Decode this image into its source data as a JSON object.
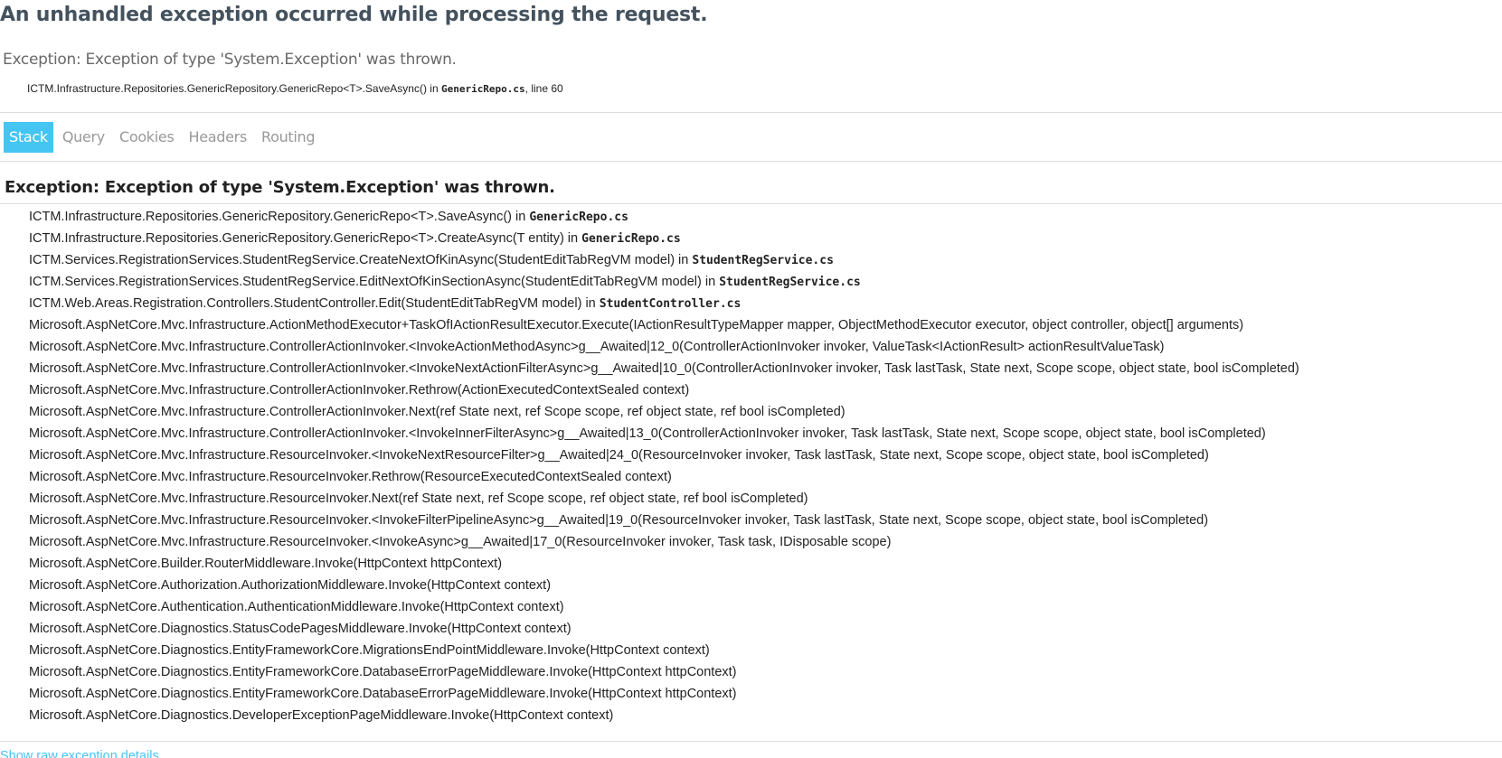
{
  "page": {
    "title": "An unhandled exception occurred while processing the request.",
    "summary": "Exception: Exception of type 'System.Exception' was thrown.",
    "location": {
      "method": "ICTM.Infrastructure.Repositories.GenericRepository.GenericRepo<T>.SaveAsync() in ",
      "file": "GenericRepo.cs",
      "line": ", line 60"
    }
  },
  "tabs": [
    {
      "label": "Stack",
      "selected": true
    },
    {
      "label": "Query",
      "selected": false
    },
    {
      "label": "Cookies",
      "selected": false
    },
    {
      "label": "Headers",
      "selected": false
    },
    {
      "label": "Routing",
      "selected": false
    }
  ],
  "stack": {
    "heading": "Exception: Exception of type 'System.Exception' was thrown.",
    "frames": [
      {
        "method": "ICTM.Infrastructure.Repositories.GenericRepository.GenericRepo<T>.SaveAsync() in ",
        "file": "GenericRepo.cs"
      },
      {
        "method": "ICTM.Infrastructure.Repositories.GenericRepository.GenericRepo<T>.CreateAsync(T entity) in ",
        "file": "GenericRepo.cs"
      },
      {
        "method": "ICTM.Services.RegistrationServices.StudentRegService.CreateNextOfKinAsync(StudentEditTabRegVM model) in ",
        "file": "StudentRegService.cs"
      },
      {
        "method": "ICTM.Services.RegistrationServices.StudentRegService.EditNextOfKinSectionAsync(StudentEditTabRegVM model) in ",
        "file": "StudentRegService.cs"
      },
      {
        "method": "ICTM.Web.Areas.Registration.Controllers.StudentController.Edit(StudentEditTabRegVM model) in ",
        "file": "StudentController.cs"
      },
      {
        "method": "Microsoft.AspNetCore.Mvc.Infrastructure.ActionMethodExecutor+TaskOfIActionResultExecutor.Execute(IActionResultTypeMapper mapper, ObjectMethodExecutor executor, object controller, object[] arguments)",
        "file": ""
      },
      {
        "method": "Microsoft.AspNetCore.Mvc.Infrastructure.ControllerActionInvoker.<InvokeActionMethodAsync>g__Awaited|12_0(ControllerActionInvoker invoker, ValueTask<IActionResult> actionResultValueTask)",
        "file": ""
      },
      {
        "method": "Microsoft.AspNetCore.Mvc.Infrastructure.ControllerActionInvoker.<InvokeNextActionFilterAsync>g__Awaited|10_0(ControllerActionInvoker invoker, Task lastTask, State next, Scope scope, object state, bool isCompleted)",
        "file": ""
      },
      {
        "method": "Microsoft.AspNetCore.Mvc.Infrastructure.ControllerActionInvoker.Rethrow(ActionExecutedContextSealed context)",
        "file": ""
      },
      {
        "method": "Microsoft.AspNetCore.Mvc.Infrastructure.ControllerActionInvoker.Next(ref State next, ref Scope scope, ref object state, ref bool isCompleted)",
        "file": ""
      },
      {
        "method": "Microsoft.AspNetCore.Mvc.Infrastructure.ControllerActionInvoker.<InvokeInnerFilterAsync>g__Awaited|13_0(ControllerActionInvoker invoker, Task lastTask, State next, Scope scope, object state, bool isCompleted)",
        "file": ""
      },
      {
        "method": "Microsoft.AspNetCore.Mvc.Infrastructure.ResourceInvoker.<InvokeNextResourceFilter>g__Awaited|24_0(ResourceInvoker invoker, Task lastTask, State next, Scope scope, object state, bool isCompleted)",
        "file": ""
      },
      {
        "method": "Microsoft.AspNetCore.Mvc.Infrastructure.ResourceInvoker.Rethrow(ResourceExecutedContextSealed context)",
        "file": ""
      },
      {
        "method": "Microsoft.AspNetCore.Mvc.Infrastructure.ResourceInvoker.Next(ref State next, ref Scope scope, ref object state, ref bool isCompleted)",
        "file": ""
      },
      {
        "method": "Microsoft.AspNetCore.Mvc.Infrastructure.ResourceInvoker.<InvokeFilterPipelineAsync>g__Awaited|19_0(ResourceInvoker invoker, Task lastTask, State next, Scope scope, object state, bool isCompleted)",
        "file": ""
      },
      {
        "method": "Microsoft.AspNetCore.Mvc.Infrastructure.ResourceInvoker.<InvokeAsync>g__Awaited|17_0(ResourceInvoker invoker, Task task, IDisposable scope)",
        "file": ""
      },
      {
        "method": "Microsoft.AspNetCore.Builder.RouterMiddleware.Invoke(HttpContext httpContext)",
        "file": ""
      },
      {
        "method": "Microsoft.AspNetCore.Authorization.AuthorizationMiddleware.Invoke(HttpContext context)",
        "file": ""
      },
      {
        "method": "Microsoft.AspNetCore.Authentication.AuthenticationMiddleware.Invoke(HttpContext context)",
        "file": ""
      },
      {
        "method": "Microsoft.AspNetCore.Diagnostics.StatusCodePagesMiddleware.Invoke(HttpContext context)",
        "file": ""
      },
      {
        "method": "Microsoft.AspNetCore.Diagnostics.EntityFrameworkCore.MigrationsEndPointMiddleware.Invoke(HttpContext context)",
        "file": ""
      },
      {
        "method": "Microsoft.AspNetCore.Diagnostics.EntityFrameworkCore.DatabaseErrorPageMiddleware.Invoke(HttpContext httpContext)",
        "file": ""
      },
      {
        "method": "Microsoft.AspNetCore.Diagnostics.EntityFrameworkCore.DatabaseErrorPageMiddleware.Invoke(HttpContext httpContext)",
        "file": ""
      },
      {
        "method": "Microsoft.AspNetCore.Diagnostics.DeveloperExceptionPageMiddleware.Invoke(HttpContext context)",
        "file": ""
      }
    ]
  },
  "footer": {
    "raw_link": "Show raw exception details"
  },
  "colors": {
    "accent": "#44c5f2",
    "title": "#44525e",
    "muted": "#999999"
  }
}
